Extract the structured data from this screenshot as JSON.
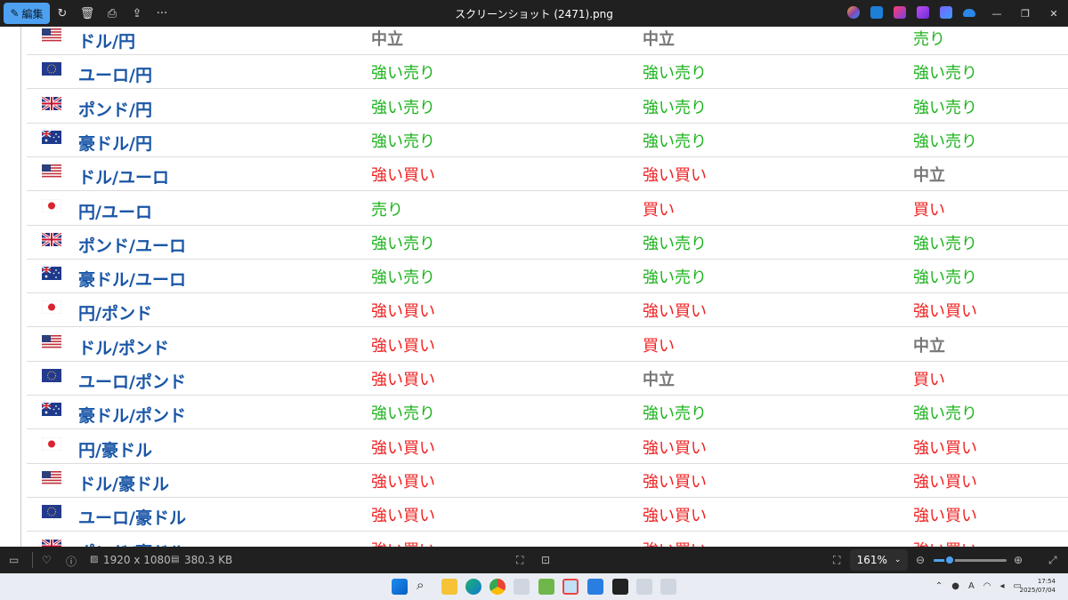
{
  "titlebar": {
    "edit_label": "編集",
    "title": "スクリーンショット (2471).png"
  },
  "table": {
    "rows": [
      {
        "flag": "us",
        "pair": "ドル/円",
        "s1": "中立",
        "s1c": "gray",
        "s2": "中立",
        "s2c": "gray",
        "s3": "売り",
        "s3c": "green"
      },
      {
        "flag": "eu",
        "pair": "ユーロ/円",
        "s1": "強い売り",
        "s1c": "green",
        "s2": "強い売り",
        "s2c": "green",
        "s3": "強い売り",
        "s3c": "green"
      },
      {
        "flag": "gb",
        "pair": "ポンド/円",
        "s1": "強い売り",
        "s1c": "green",
        "s2": "強い売り",
        "s2c": "green",
        "s3": "強い売り",
        "s3c": "green"
      },
      {
        "flag": "au",
        "pair": "豪ドル/円",
        "s1": "強い売り",
        "s1c": "green",
        "s2": "強い売り",
        "s2c": "green",
        "s3": "強い売り",
        "s3c": "green"
      },
      {
        "flag": "us",
        "pair": "ドル/ユーロ",
        "s1": "強い買い",
        "s1c": "red",
        "s2": "強い買い",
        "s2c": "red",
        "s3": "中立",
        "s3c": "gray"
      },
      {
        "flag": "jp",
        "pair": "円/ユーロ",
        "s1": "売り",
        "s1c": "green",
        "s2": "買い",
        "s2c": "red",
        "s3": "買い",
        "s3c": "red"
      },
      {
        "flag": "gb",
        "pair": "ポンド/ユーロ",
        "s1": "強い売り",
        "s1c": "green",
        "s2": "強い売り",
        "s2c": "green",
        "s3": "強い売り",
        "s3c": "green"
      },
      {
        "flag": "au",
        "pair": "豪ドル/ユーロ",
        "s1": "強い売り",
        "s1c": "green",
        "s2": "強い売り",
        "s2c": "green",
        "s3": "強い売り",
        "s3c": "green"
      },
      {
        "flag": "jp",
        "pair": "円/ポンド",
        "s1": "強い買い",
        "s1c": "red",
        "s2": "強い買い",
        "s2c": "red",
        "s3": "強い買い",
        "s3c": "red"
      },
      {
        "flag": "us",
        "pair": "ドル/ポンド",
        "s1": "強い買い",
        "s1c": "red",
        "s2": "買い",
        "s2c": "red",
        "s3": "中立",
        "s3c": "gray"
      },
      {
        "flag": "eu",
        "pair": "ユーロ/ポンド",
        "s1": "強い買い",
        "s1c": "red",
        "s2": "中立",
        "s2c": "gray",
        "s3": "買い",
        "s3c": "red"
      },
      {
        "flag": "au",
        "pair": "豪ドル/ポンド",
        "s1": "強い売り",
        "s1c": "green",
        "s2": "強い売り",
        "s2c": "green",
        "s3": "強い売り",
        "s3c": "green"
      },
      {
        "flag": "jp",
        "pair": "円/豪ドル",
        "s1": "強い買い",
        "s1c": "red",
        "s2": "強い買い",
        "s2c": "red",
        "s3": "強い買い",
        "s3c": "red"
      },
      {
        "flag": "us",
        "pair": "ドル/豪ドル",
        "s1": "強い買い",
        "s1c": "red",
        "s2": "強い買い",
        "s2c": "red",
        "s3": "強い買い",
        "s3c": "red"
      },
      {
        "flag": "eu",
        "pair": "ユーロ/豪ドル",
        "s1": "強い買い",
        "s1c": "red",
        "s2": "強い買い",
        "s2c": "red",
        "s3": "強い買い",
        "s3c": "red"
      },
      {
        "flag": "gb",
        "pair": "ポンド/豪ドル",
        "s1": "強い買い",
        "s1c": "red",
        "s2": "強い買い",
        "s2c": "red",
        "s3": "強い買い",
        "s3c": "red"
      }
    ]
  },
  "status": {
    "dimensions": "1920 x 1080",
    "filesize": "380.3 KB",
    "zoom": "161%",
    "zoom_level": 0.22
  },
  "clock": {
    "time": "17:54",
    "date": "2025/07/04"
  },
  "colors": {
    "accent": "#4ea1f0",
    "pair_text": "#1a56a6",
    "sell": "#1db31d",
    "buy": "#ee2222",
    "neutral": "#777777"
  }
}
